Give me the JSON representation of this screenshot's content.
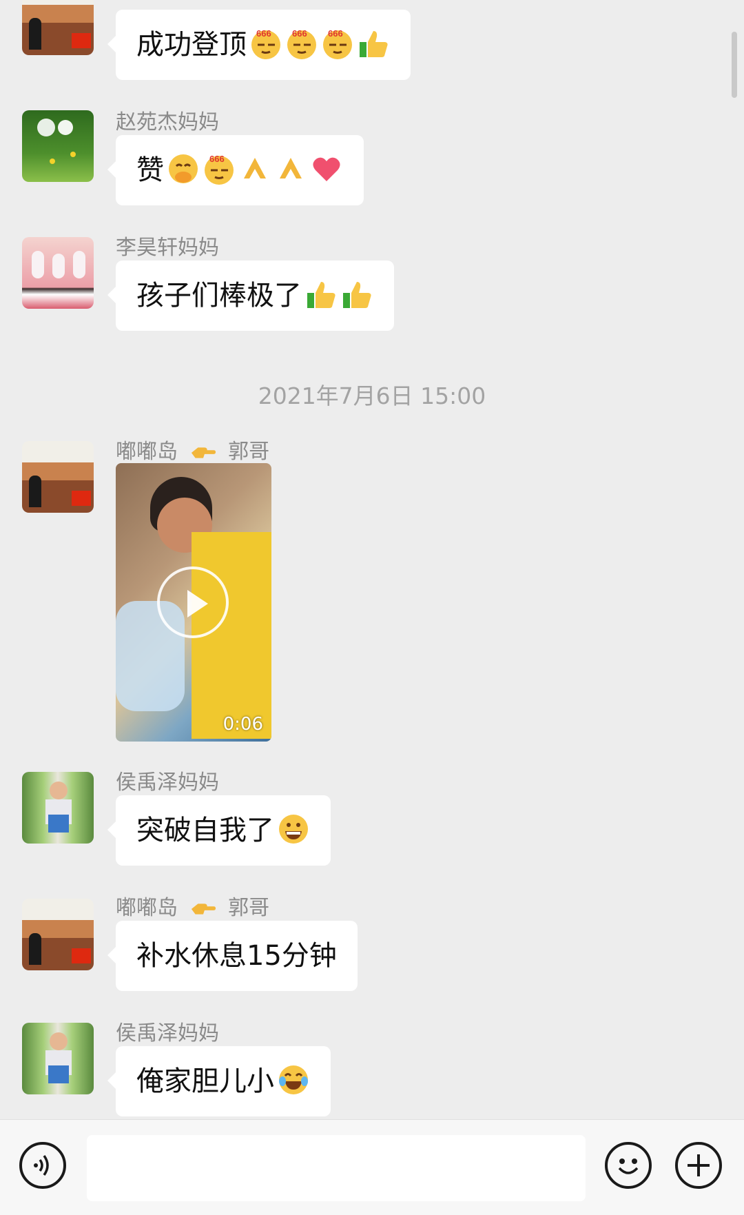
{
  "messages": [
    {
      "sender": "",
      "text": "成功登顶",
      "emojis": [
        "smug-666-emoji",
        "smug-666-emoji",
        "smug-666-emoji",
        "thumbs-up-emoji"
      ]
    },
    {
      "sender": "赵苑杰妈妈",
      "text": "赞",
      "emojis": [
        "grin-hands-emoji",
        "smug-666-emoji",
        "clap-emoji",
        "clap-emoji",
        "heart-emoji"
      ]
    },
    {
      "sender": "李昊轩妈妈",
      "text": "孩子们棒极了",
      "emojis": [
        "thumbs-up-emoji",
        "thumbs-up-emoji"
      ]
    }
  ],
  "timestamp": "2021年7月6日 15:00",
  "video_message": {
    "sender_left": "嘟嘟岛",
    "sender_right": "郭哥",
    "duration": "0:06"
  },
  "messages_after": [
    {
      "sender": "侯禹泽妈妈",
      "text": "突破自我了",
      "emojis": [
        "grin-emoji"
      ]
    },
    {
      "sender_left": "嘟嘟岛",
      "sender_right": "郭哥",
      "text": "补水休息15分钟",
      "emojis": []
    },
    {
      "sender": "侯禹泽妈妈",
      "text": "俺家胆儿小",
      "emojis": [
        "laugh-tears-emoji"
      ]
    }
  ],
  "colors": {
    "background": "#ededed",
    "bubble": "#ffffff",
    "sender_text": "#8a8a8a",
    "timestamp_text": "#a3a3a3"
  },
  "input_bar": {
    "icons": [
      "voice-icon",
      "emoji-icon",
      "plus-icon"
    ]
  }
}
